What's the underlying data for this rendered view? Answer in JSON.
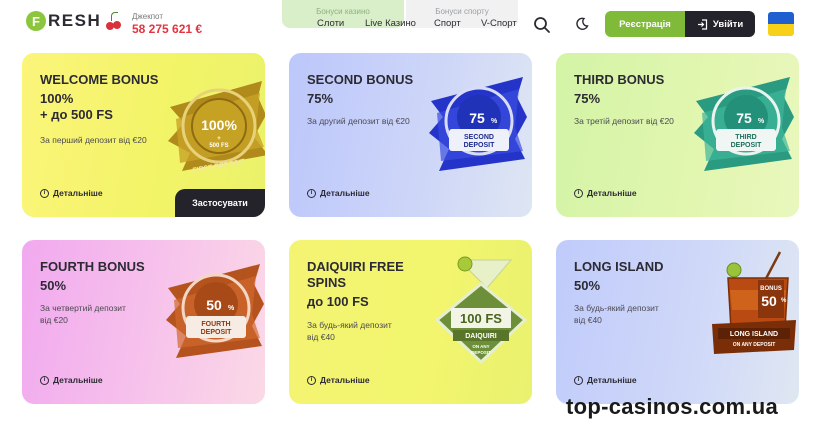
{
  "header": {
    "logo_text": "RESH",
    "logo_letter": "F",
    "jackpot_label": "Джекпот",
    "jackpot_value": "58 275 621 €",
    "tab_casino_bonus": "Бонуси казино",
    "tab_sport_bonus": "Бонуси спорту",
    "nav": [
      "Слоти",
      "Live Казино",
      "Спорт",
      "V-Спорт"
    ],
    "register_label": "Реєстрація",
    "login_label": "Увійти",
    "icons": [
      "search-icon",
      "moon-icon",
      "login-icon",
      "ukraine-flag-icon"
    ]
  },
  "cards": [
    {
      "title": "WELCOME BONUS",
      "amount": "100%\n+ до 500 FS",
      "desc": "За перший депозит від €20",
      "more": "Детальніше",
      "apply": "Застосувати",
      "badge_main": "100%",
      "badge_sub": "+\n500 FS",
      "badge_ring": "FIRST DEPOSIT"
    },
    {
      "title": "SECOND BONUS",
      "amount": "75%",
      "desc": "За другий депозит від €20",
      "more": "Детальніше",
      "badge_main": "75",
      "badge_pct": "%",
      "badge_sub": "SECOND\nDEPOSIT"
    },
    {
      "title": "THIRD BONUS",
      "amount": "75%",
      "desc": "За третій депозит від €20",
      "more": "Детальніше",
      "badge_main": "75",
      "badge_pct": "%",
      "badge_sub": "THIRD\nDEPOSIT"
    },
    {
      "title": "FOURTH BONUS",
      "amount": "50%",
      "desc": "За четвертий депозит\nвід €20",
      "more": "Детальніше",
      "badge_main": "50",
      "badge_pct": "%",
      "badge_sub": "FOURTH\nDEPOSIT"
    },
    {
      "title": "DAIQUIRI FREE\nSPINS",
      "amount": "до 100 FS",
      "desc": "За будь-який депозит\nвід €40",
      "more": "Детальніше",
      "badge_main": "100 FS",
      "badge_sub": "DAIQUIRI",
      "badge_ring": "ON ANY\nDEPOSIT"
    },
    {
      "title": "LONG ISLAND",
      "amount": "50%",
      "desc": "За будь-який депозит\nвід €40",
      "more": "Детальніше",
      "badge_top": "BONUS",
      "badge_main": "50",
      "badge_pct": "%",
      "badge_sub": "LONG ISLAND",
      "badge_ring": "ON ANY DEPOSIT"
    }
  ],
  "info_glyph": "i",
  "watermark": "top-casinos.com.ua",
  "colors": {
    "accent_green": "#7fba38",
    "dark": "#24222a",
    "jackpot_red": "#e3343f"
  }
}
